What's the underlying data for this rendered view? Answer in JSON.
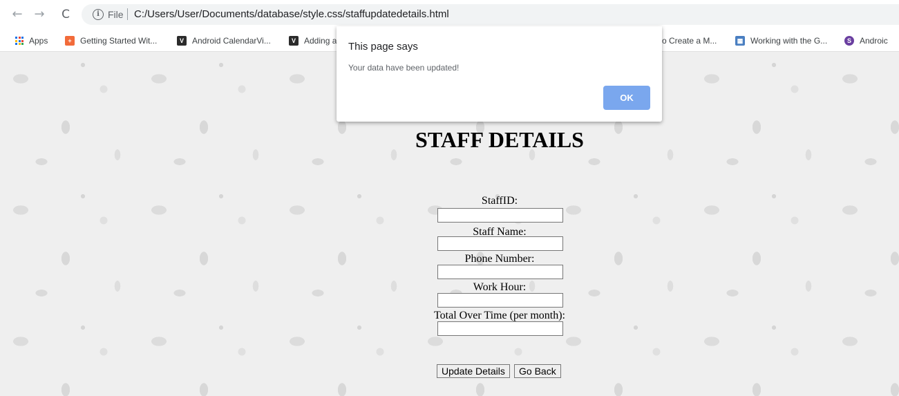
{
  "browser": {
    "back_icon": "←",
    "forward_icon": "→",
    "reload_icon": "C",
    "info_icon": "i",
    "scheme": "File",
    "url": "C:/Users/User/Documents/database/style.css/staffupdatedetails.html"
  },
  "bookmarks": [
    {
      "label": "Apps"
    },
    {
      "label": "Getting Started Wit...",
      "icon_color": "#f26b3a"
    },
    {
      "label": "Android CalendarVi...",
      "icon": "V",
      "icon_color": "#2b2b2b"
    },
    {
      "label": "Adding a",
      "icon": "V",
      "icon_color": "#2b2b2b"
    },
    {
      "label": "o Create a M..."
    },
    {
      "label": "Working with the G...",
      "icon_color": "#4a7fc1"
    },
    {
      "label": "Androic",
      "icon": "S",
      "icon_color": "#6a3fa0"
    }
  ],
  "page": {
    "title": "STAFF DETAILS",
    "fields": [
      {
        "label": "StaffID:",
        "value": ""
      },
      {
        "label": "Staff Name:",
        "value": ""
      },
      {
        "label": "Phone Number:",
        "value": ""
      },
      {
        "label": "Work Hour:",
        "value": ""
      },
      {
        "label": "Total Over Time (per month):",
        "value": ""
      }
    ],
    "update_button": "Update Details",
    "back_button": "Go Back"
  },
  "dialog": {
    "title": "This page says",
    "message": "Your data have been updated!",
    "ok_label": "OK",
    "ok_color": "#7aa7ee"
  }
}
